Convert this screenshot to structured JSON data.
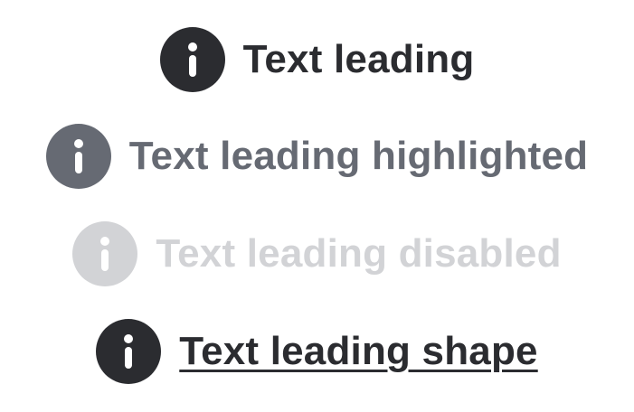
{
  "buttons": [
    {
      "label": "Text leading",
      "icon": "info-circle-icon",
      "state": "normal",
      "color": "#2b2c30",
      "glyph_color": "#ffffff",
      "underline": false
    },
    {
      "label": "Text leading highlighted",
      "icon": "info-circle-icon",
      "state": "highlighted",
      "color": "#666a73",
      "glyph_color": "#ffffff",
      "underline": false
    },
    {
      "label": "Text leading disabled",
      "icon": "info-circle-icon",
      "state": "disabled",
      "color": "#d2d3d6",
      "glyph_color": "#ffffff",
      "underline": false
    },
    {
      "label": "Text leading shape",
      "icon": "info-circle-icon",
      "state": "shape",
      "color": "#2b2c30",
      "glyph_color": "#ffffff",
      "underline": true
    }
  ]
}
